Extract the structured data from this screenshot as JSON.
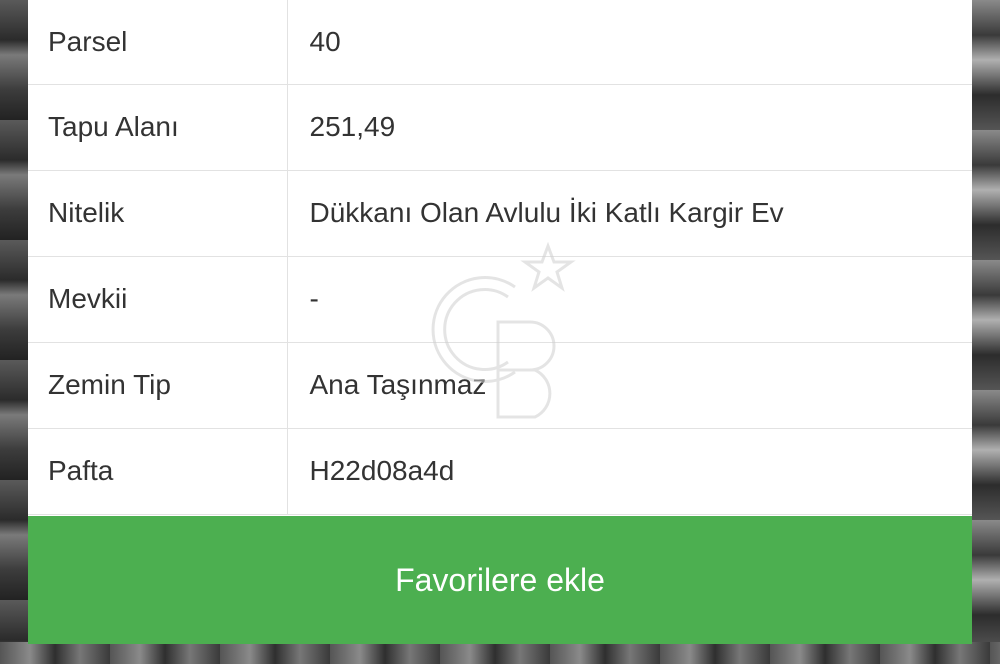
{
  "details": [
    {
      "label": "Parsel",
      "value": "40"
    },
    {
      "label": "Tapu Alanı",
      "value": "251,49"
    },
    {
      "label": "Nitelik",
      "value": "Dükkanı Olan Avlulu İki Katlı Kargir Ev"
    },
    {
      "label": "Mevkii",
      "value": "-"
    },
    {
      "label": "Zemin Tip",
      "value": "Ana Taşınmaz"
    },
    {
      "label": "Pafta",
      "value": "H22d08a4d"
    }
  ],
  "actions": {
    "favorite_label": "Favorilere ekle"
  },
  "watermark": {
    "icon": "cb-logo-icon"
  },
  "colors": {
    "accent": "#4caf50",
    "text": "#333333",
    "divider": "#e2e2e2"
  }
}
